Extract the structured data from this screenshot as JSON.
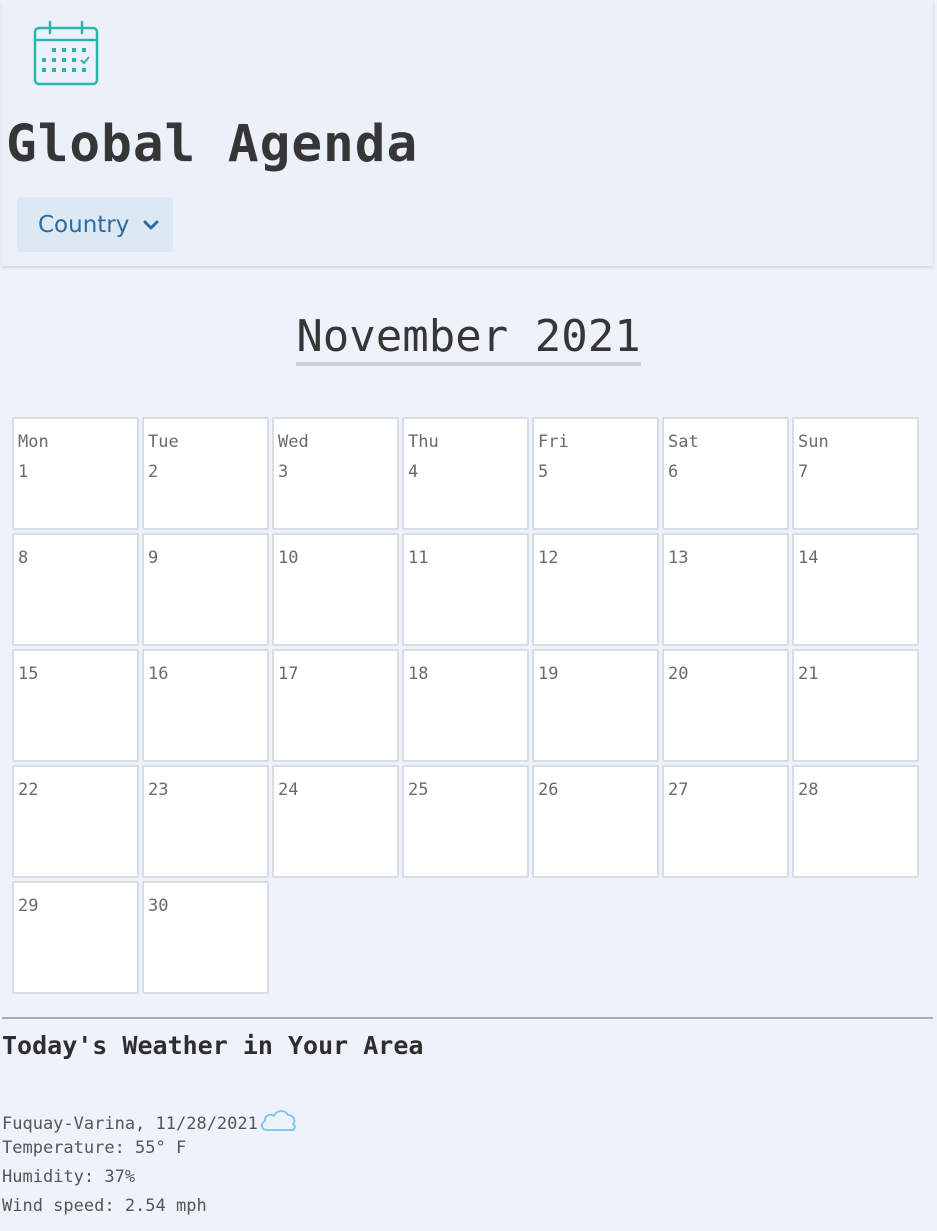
{
  "header": {
    "logo_icon": "calendar-check-icon",
    "title": "Global Agenda",
    "country_button": {
      "label": "Country",
      "icon": "chevron-down-icon"
    }
  },
  "calendar": {
    "month_title": "November 2021",
    "day_names": [
      "Mon",
      "Tue",
      "Wed",
      "Thu",
      "Fri",
      "Sat",
      "Sun"
    ],
    "weeks": [
      [
        "1",
        "2",
        "3",
        "4",
        "5",
        "6",
        "7"
      ],
      [
        "8",
        "9",
        "10",
        "11",
        "12",
        "13",
        "14"
      ],
      [
        "15",
        "16",
        "17",
        "18",
        "19",
        "20",
        "21"
      ],
      [
        "22",
        "23",
        "24",
        "25",
        "26",
        "27",
        "28"
      ],
      [
        "29",
        "30",
        "",
        "",
        "",
        "",
        ""
      ]
    ]
  },
  "weather": {
    "heading": "Today's Weather in Your Area",
    "location_date": "Fuquay-Varina, 11/28/2021",
    "condition_icon": "cloud-icon",
    "temperature": "Temperature: 55° F",
    "humidity": "Humidity: 37%",
    "wind_speed": "Wind speed: 2.54 mph"
  },
  "colors": {
    "page_bg": "#eef3fb",
    "accent_teal": "#2bb5ad",
    "button_bg": "#dce9f5",
    "button_text": "#2f6aa0"
  }
}
